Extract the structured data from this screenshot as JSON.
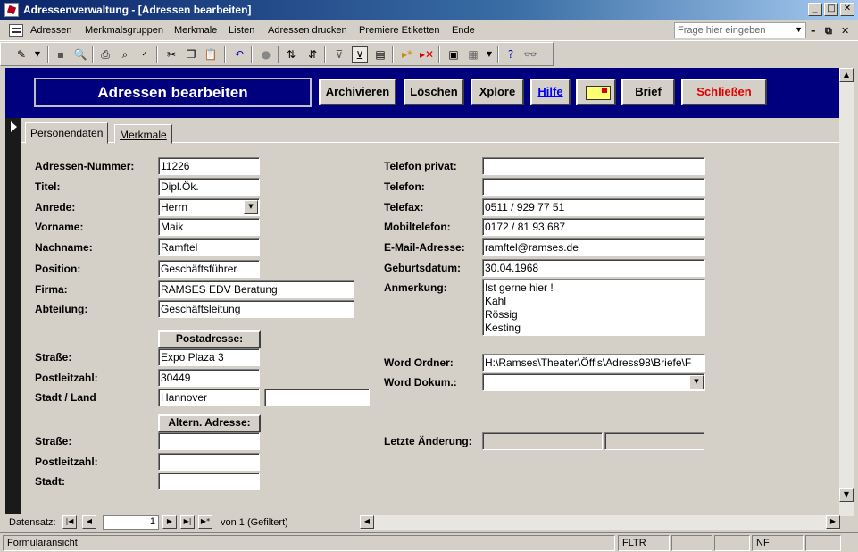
{
  "window": {
    "title": "Adressenverwaltung - [Adressen bearbeiten]"
  },
  "menu": {
    "items": [
      "Adressen",
      "Merkmalsgruppen",
      "Merkmale",
      "Listen",
      "Adressen drucken",
      "Premiere Etiketten",
      "Ende"
    ],
    "help_placeholder": "Frage hier eingeben"
  },
  "header": {
    "title": "Adressen bearbeiten",
    "buttons": {
      "archive": "Archivieren",
      "delete": "Löschen",
      "explore": "Xplore",
      "help": "Hilfe",
      "letter": "Brief",
      "close": "Schließen"
    }
  },
  "tabs": [
    "Personendaten",
    "Merkmale"
  ],
  "form": {
    "left": {
      "adressen_nummer": {
        "label": "Adressen-Nummer:",
        "value": "11226"
      },
      "titel": {
        "label": "Titel:",
        "value": "Dipl.Ök."
      },
      "anrede": {
        "label": "Anrede:",
        "value": "Herrn"
      },
      "vorname": {
        "label": "Vorname:",
        "value": "Maik"
      },
      "nachname": {
        "label": "Nachname:",
        "value": "Ramftel"
      },
      "position": {
        "label": "Position:",
        "value": "Geschäftsführer"
      },
      "firma": {
        "label": "Firma:",
        "value": "RAMSES EDV Beratung"
      },
      "abteilung": {
        "label": "Abteilung:",
        "value": "Geschäftsleitung"
      }
    },
    "postadresse": {
      "button": "Postadresse:",
      "strasse": {
        "label": "Straße:",
        "value": "Expo Plaza 3"
      },
      "plz": {
        "label": "Postleitzahl:",
        "value": "30449"
      },
      "stadt": {
        "label": "Stadt / Land",
        "value": "Hannover",
        "land": ""
      }
    },
    "altern": {
      "button": "Altern. Adresse:",
      "strasse": {
        "label": "Straße:",
        "value": ""
      },
      "plz": {
        "label": "Postleitzahl:",
        "value": ""
      },
      "stadt": {
        "label": "Stadt:",
        "value": ""
      }
    },
    "right": {
      "telefon_privat": {
        "label": "Telefon privat:",
        "value": ""
      },
      "telefon": {
        "label": "Telefon:",
        "value": ""
      },
      "telefax": {
        "label": "Telefax:",
        "value": "0511 / 929 77 51"
      },
      "mobil": {
        "label": "Mobiltelefon:",
        "value": "0172 / 81 93 687"
      },
      "email": {
        "label": "E-Mail-Adresse:",
        "value": "ramftel@ramses.de"
      },
      "geburtsdatum": {
        "label": "Geburtsdatum:",
        "value": "30.04.1968"
      },
      "anmerkung": {
        "label": "Anmerkung:",
        "lines": [
          "Ist gerne hier !",
          "Kahl",
          "Rössig",
          "Kesting"
        ]
      },
      "word_ordner": {
        "label": "Word Ordner:",
        "value": "H:\\Ramses\\Theater\\Öffis\\Adress98\\Briefe\\F"
      },
      "word_dokum": {
        "label": "Word Dokum.:",
        "value": ""
      },
      "letzte_aenderung": {
        "label": "Letzte Änderung:",
        "value1": "",
        "value2": ""
      }
    }
  },
  "nav": {
    "label": "Datensatz:",
    "current": "1",
    "of_text": "von  1 (Gefiltert)"
  },
  "status": {
    "mode": "Formularansicht",
    "fltr": "FLTR",
    "nf": "NF"
  }
}
